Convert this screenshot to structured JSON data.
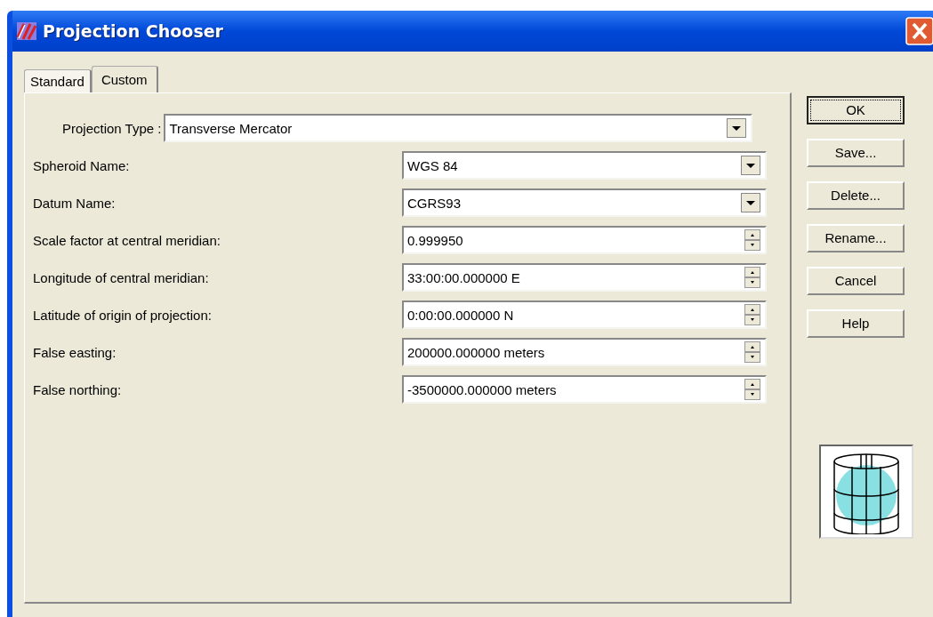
{
  "window": {
    "title": "Projection Chooser"
  },
  "tabs": [
    {
      "label": "Standard",
      "selected": false
    },
    {
      "label": "Custom",
      "selected": true
    }
  ],
  "projection_type": {
    "label": "Projection Type :",
    "value": "Transverse Mercator"
  },
  "fields": [
    {
      "label": "Spheroid Name:",
      "value": "WGS 84",
      "kind": "combo"
    },
    {
      "label": "Datum Name:",
      "value": "CGRS93",
      "kind": "combo"
    },
    {
      "label": "Scale factor at central meridian:",
      "value": "0.999950",
      "kind": "spin"
    },
    {
      "label": "Longitude of central meridian:",
      "value": "33:00:00.000000 E",
      "kind": "spin"
    },
    {
      "label": "Latitude of origin of projection:",
      "value": "0:00:00.000000 N",
      "kind": "spin"
    },
    {
      "label": "False easting:",
      "value": "200000.000000 meters",
      "kind": "spin"
    },
    {
      "label": "False northing:",
      "value": "-3500000.000000 meters",
      "kind": "spin"
    }
  ],
  "buttons": [
    {
      "label": "OK",
      "focused": true
    },
    {
      "label": "Save...",
      "focused": false
    },
    {
      "label": "Delete...",
      "focused": false
    },
    {
      "label": "Rename...",
      "focused": false
    },
    {
      "label": "Cancel",
      "focused": false
    },
    {
      "label": "Help",
      "focused": false
    }
  ]
}
